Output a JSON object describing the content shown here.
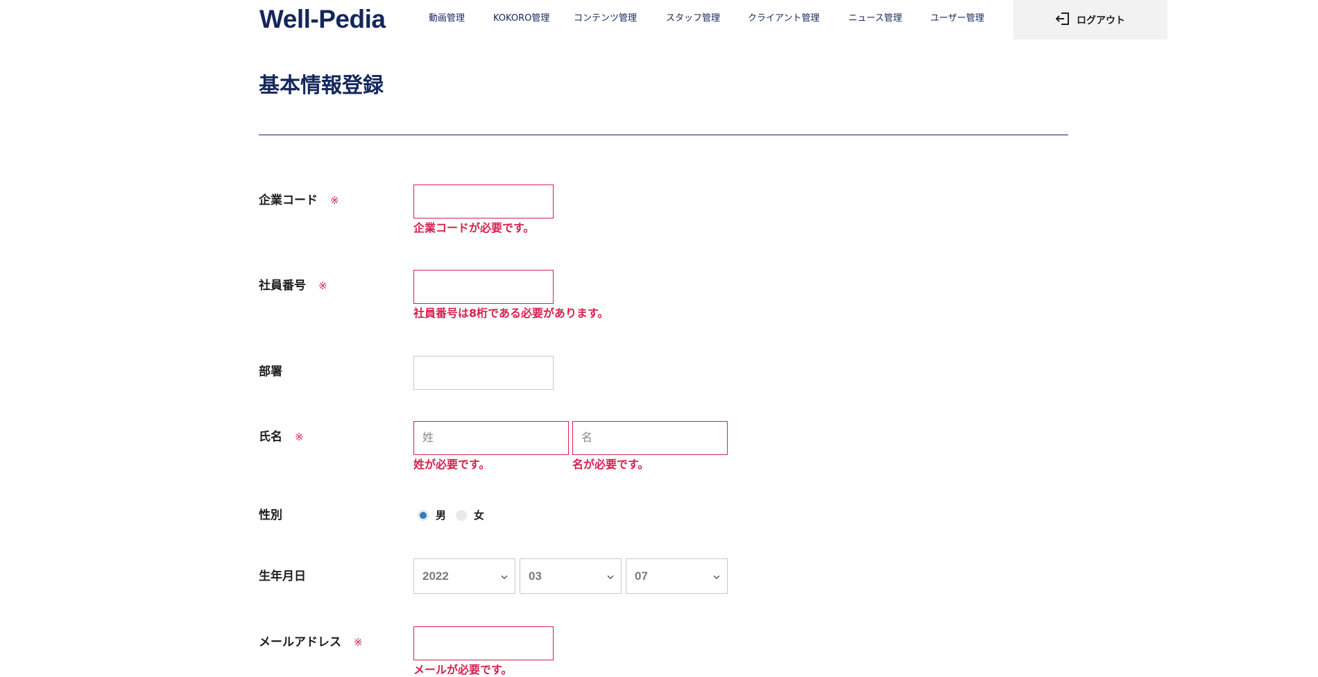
{
  "header": {
    "logo": "Well-Pedia",
    "nav": [
      "動画管理",
      "KOKORO管理",
      "コンテンツ管理",
      "スタッフ管理",
      "クライアント管理",
      "ニュース管理",
      "ユーザー管理"
    ],
    "logout_label": "ログアウト",
    "logout_icon": "logout-icon"
  },
  "page": {
    "title": "基本情報登録"
  },
  "form": {
    "required_mark": "※",
    "company_code": {
      "label": "企業コード",
      "value": "",
      "error": "企業コードが必要です。"
    },
    "employee_number": {
      "label": "社員番号",
      "value": "",
      "error": "社員番号は8桁である必要があります。"
    },
    "department": {
      "label": "部署",
      "value": ""
    },
    "name": {
      "label": "氏名",
      "last_placeholder": "姓",
      "last_error": "姓が必要です。",
      "first_placeholder": "名",
      "first_error": "名が必要です。"
    },
    "gender": {
      "label": "性別",
      "options": [
        "男",
        "女"
      ],
      "selected": "男"
    },
    "birthday": {
      "label": "生年月日",
      "year": "2022",
      "month": "03",
      "day": "07"
    },
    "email": {
      "label": "メールアドレス",
      "value": "",
      "error": "メールが必要です。"
    }
  },
  "colors": {
    "brand": "#14265c",
    "error": "#d6204e",
    "radio_selected": "#2d7fc1"
  }
}
